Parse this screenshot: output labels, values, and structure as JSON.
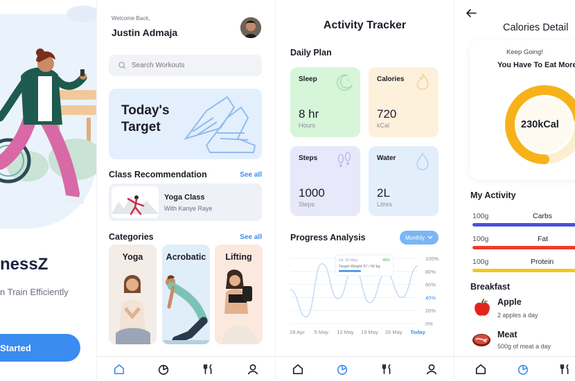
{
  "onboarding": {
    "brand": "nessZ",
    "tagline": "n Train Efficiently",
    "cta": "Started"
  },
  "home": {
    "welcome": "Welcome Back,",
    "user_name": "Justin Admaja",
    "search_placeholder": "Search Workouts",
    "target_title": "Today's Target",
    "class_section": {
      "title": "Class Recommendation",
      "link": "See all"
    },
    "class_item": {
      "name": "Yoga Class",
      "coach": "With Kanye Raye"
    },
    "categories_section": {
      "title": "Categories",
      "link": "See all"
    },
    "categories": [
      "Yoga",
      "Acrobatic",
      "Lifting"
    ]
  },
  "tracker": {
    "title": "Activity Tracker",
    "daily_plan": "Daily Plan",
    "stats": [
      {
        "name": "Sleep",
        "value": "8 hr",
        "unit": "Hours",
        "color": "#d6f5d9",
        "icon": "moon-icon"
      },
      {
        "name": "Calories",
        "value": "720",
        "unit": "kCal",
        "color": "#fdf1dc",
        "icon": "flame-icon"
      },
      {
        "name": "Steps",
        "value": "1000",
        "unit": "Steps",
        "color": "#e7e8fa",
        "icon": "footsteps-icon"
      },
      {
        "name": "Water",
        "value": "2L",
        "unit": "Litres",
        "color": "#e3eefb",
        "icon": "water-drop-icon"
      }
    ],
    "progress_title": "Progress Analysis",
    "period": "Monthly",
    "tooltip": {
      "date": "14, 26 May",
      "percent": "40%",
      "text": "Target Weight 67 / 56 kg"
    }
  },
  "chart_data": {
    "type": "line",
    "x": [
      "28 Apr",
      "5 May",
      "12 May",
      "19 May",
      "26 May",
      "Today"
    ],
    "y_ticks": [
      "100%",
      "80%",
      "60%",
      "40%",
      "20%",
      "0%"
    ],
    "ylim": [
      0,
      100
    ],
    "highlight_tick": "40%",
    "highlight_x": "Today",
    "series": [
      {
        "values": [
          52,
          10,
          92,
          38,
          86,
          32,
          78,
          40,
          88
        ]
      }
    ]
  },
  "calories": {
    "title": "Calories Detail",
    "keep_going": "Keep Going!",
    "eat_more": "You Have To Eat More",
    "kcal": "230kCal",
    "ring_fraction": 0.72,
    "my_activity": "My Activity",
    "macros": [
      {
        "amount": "100g",
        "name": "Carbs",
        "color": "#4b4fe0"
      },
      {
        "amount": "100g",
        "name": "Fat",
        "color": "#ee3b2b"
      },
      {
        "amount": "100g",
        "name": "Protein",
        "color": "#f2c61f"
      }
    ],
    "breakfast": "Breakfast",
    "foods": [
      {
        "name": "Apple",
        "desc": "2 apples a day",
        "icon": "apple-icon"
      },
      {
        "name": "Meat",
        "desc": "500g of meat a day",
        "icon": "meat-icon"
      }
    ]
  }
}
